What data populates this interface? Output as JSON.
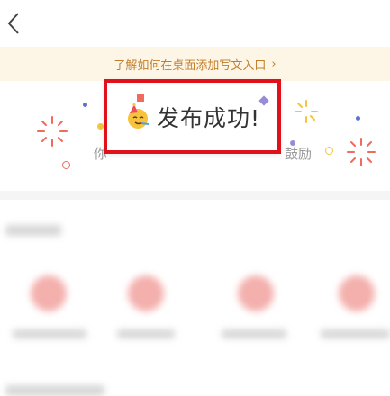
{
  "nav": {
    "back_icon": "chevron-left-icon"
  },
  "banner": {
    "text": "了解如何在桌面添加写文入口",
    "arrow": "›"
  },
  "success": {
    "title": "发布成功!",
    "hint_left": "你",
    "hint_right": "鼓励",
    "icon": "party-face-icon",
    "highlight_color": "#e0111a"
  },
  "colors": {
    "banner_bg": "#fdf6e7",
    "banner_text": "#c37d28",
    "accent": "#e0111a"
  }
}
